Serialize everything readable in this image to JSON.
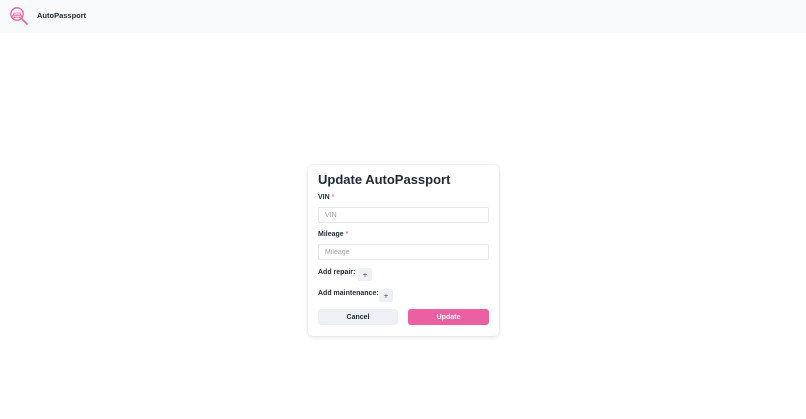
{
  "header": {
    "app_title": "AutoPassport"
  },
  "form": {
    "title": "Update AutoPassport",
    "vin": {
      "label": "VIN",
      "required_mark": "*",
      "placeholder": "VIN",
      "value": ""
    },
    "mileage": {
      "label": "Mileage",
      "required_mark": "*",
      "placeholder": "Mileage",
      "value": ""
    },
    "add_repair": {
      "label": "Add repair:",
      "button_label": "+"
    },
    "add_maintenance": {
      "label": "Add maintenance:",
      "button_label": "+"
    },
    "cancel_label": "Cancel",
    "update_label": "Update"
  },
  "colors": {
    "accent": "#ec5fa0",
    "required": "#ec4899",
    "secondary_button": "#eef0f3",
    "header_background": "#f8f9fb"
  },
  "icons": {
    "logo": "magnifier-car-logo-icon"
  }
}
